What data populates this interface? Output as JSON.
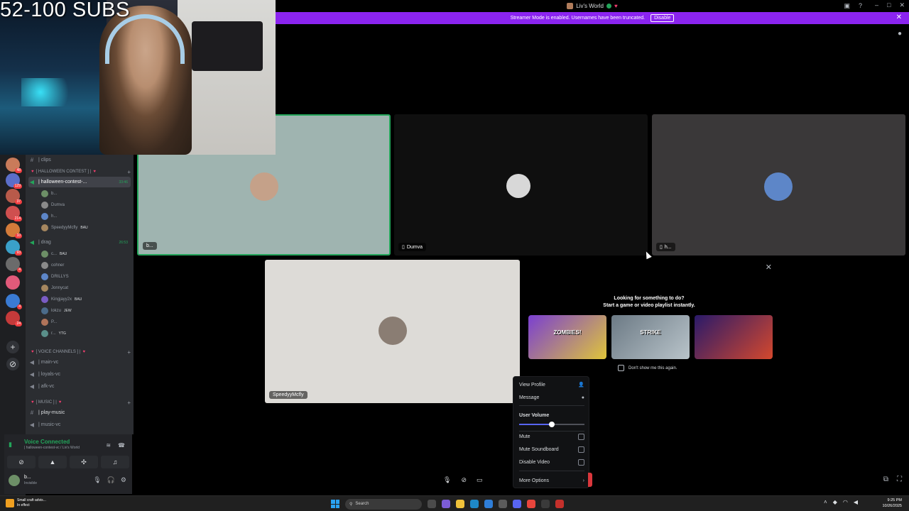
{
  "overlay": {
    "subs_text": "52-100 SUBS"
  },
  "window": {
    "title": "Liv's World",
    "controls": [
      "–",
      "□",
      "✕"
    ]
  },
  "banner": {
    "text": "Streamer Mode is enabled. Usernames have been truncated.",
    "disable_label": "Disable"
  },
  "server_rail": {
    "servers": [
      {
        "color": "#c97b5a",
        "ping": "48"
      },
      {
        "color": "#5b6ec9",
        "ping": "129"
      },
      {
        "color": "#b85a4a",
        "ping": "37"
      },
      {
        "color": "#cf4f4f",
        "ping": "214"
      },
      {
        "color": "#d37b3a",
        "ping": "10"
      },
      {
        "color": "#3aa0c9",
        "ping": "93"
      },
      {
        "color": "#6b6b6b",
        "ping": "4"
      },
      {
        "color": "#e25a7a",
        "ping": ""
      },
      {
        "color": "#3a7bd3",
        "ping": "4"
      },
      {
        "color": "#c43a3a",
        "ping": "24"
      }
    ],
    "add_icon": "+",
    "explore_icon": "⊘"
  },
  "sidebar": {
    "clips_channel": "| clips",
    "cat_halloween": "[ HALLOWEEN CONTEST ] |",
    "halloween_channel": "| halloween-contest-...",
    "halloween_timer": "33:46",
    "halloween_users": [
      {
        "name": "b...",
        "tag": ""
      },
      {
        "name": "Dumva",
        "tag": ""
      },
      {
        "name": "h...",
        "tag": ""
      },
      {
        "name": "SpeedyyMcfly",
        "tag": "BAU"
      }
    ],
    "drag_channel": "| drag",
    "drag_timer": "26:53",
    "drag_users": [
      {
        "name": "c...",
        "tag": "BAU"
      },
      {
        "name": "cohner",
        "tag": ""
      },
      {
        "name": "DRILLYS",
        "tag": ""
      },
      {
        "name": "Jonnycat",
        "tag": ""
      },
      {
        "name": "Kingjayy2x",
        "tag": "BAU"
      },
      {
        "name": "lokzu",
        "tag": "JEW"
      },
      {
        "name": "P...",
        "tag": ""
      },
      {
        "name": "r...",
        "tag": "YTG"
      }
    ],
    "cat_voice": "[ VOICE CHANNELS ] |",
    "voice_channels": [
      "| main-vc",
      "| loyals-vc",
      "| afk-vc"
    ],
    "cat_music": "[ MUSIC ] |",
    "music_channels": [
      "| play-music",
      "| music-vc"
    ]
  },
  "voice_panel": {
    "status": "Voice Connected",
    "channel": "| halloween-contest-vc / Liv's World",
    "user_name": "b...",
    "user_status": "Invisible"
  },
  "stage": {
    "tiles": [
      {
        "label": "b...",
        "bg": "#9fb4b0",
        "avatar": "#c5a189"
      },
      {
        "label": "Dumva",
        "bg": "#0f0f0f",
        "avatar": "#e8e8e8"
      },
      {
        "label": "h...",
        "bg": "#3a3839",
        "avatar": "#5d86c8"
      },
      {
        "label": "SpeedyyMcfly",
        "bg": "#dddbd7",
        "avatar": "#8a7d73"
      }
    ]
  },
  "activity": {
    "headline": "Looking for something to do?",
    "subline": "Start a game or video playlist instantly.",
    "games": [
      {
        "name": "ZOMBIES!",
        "bg": "linear-gradient(135deg,#7a3fd1,#e0c53a)"
      },
      {
        "name": "STRIKE",
        "bg": "linear-gradient(135deg,#6c7a85,#b9c4ca)"
      },
      {
        "name": "",
        "bg": "linear-gradient(135deg,#2a1a6a,#d4482d)"
      }
    ],
    "dont_show": "Don't show me this again."
  },
  "context_menu": {
    "view_profile": "View Profile",
    "message": "Message",
    "user_volume": "User Volume",
    "volume_level": 0.5,
    "mute": "Mute",
    "mute_soundboard": "Mute Soundboard",
    "disable_video": "Disable Video",
    "more_options": "More Options"
  },
  "taskbar": {
    "weather_title": "Small craft advis...",
    "weather_sub": "In effect",
    "search_placeholder": "Search",
    "time": "9:25 PM",
    "date": "10/26/2025"
  }
}
